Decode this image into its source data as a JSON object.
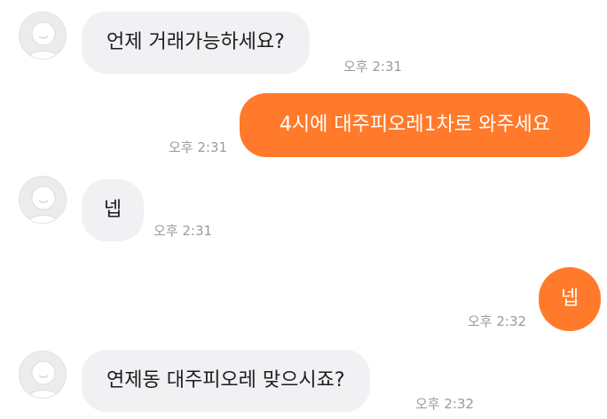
{
  "messages": [
    {
      "direction": "incoming",
      "text": "언제 거래가능하세요?",
      "time": "오후 2:31"
    },
    {
      "direction": "outgoing",
      "text": "4시에 대주피오레1차로 와주세요",
      "time": "오후 2:31"
    },
    {
      "direction": "incoming",
      "text": "넵",
      "time": "오후 2:31"
    },
    {
      "direction": "outgoing",
      "text": "넵",
      "time": "오후 2:32"
    },
    {
      "direction": "incoming",
      "text": "연제동 대주피오레 맞으시죠?",
      "time": "오후 2:32"
    }
  ],
  "icons": {
    "avatar": "default-profile-avatar-icon"
  },
  "colors": {
    "outgoing_bubble": "#ff7a2a",
    "incoming_bubble": "#f1f1f4",
    "timestamp": "#9a9aa0",
    "avatar_bg": "#ececef"
  }
}
